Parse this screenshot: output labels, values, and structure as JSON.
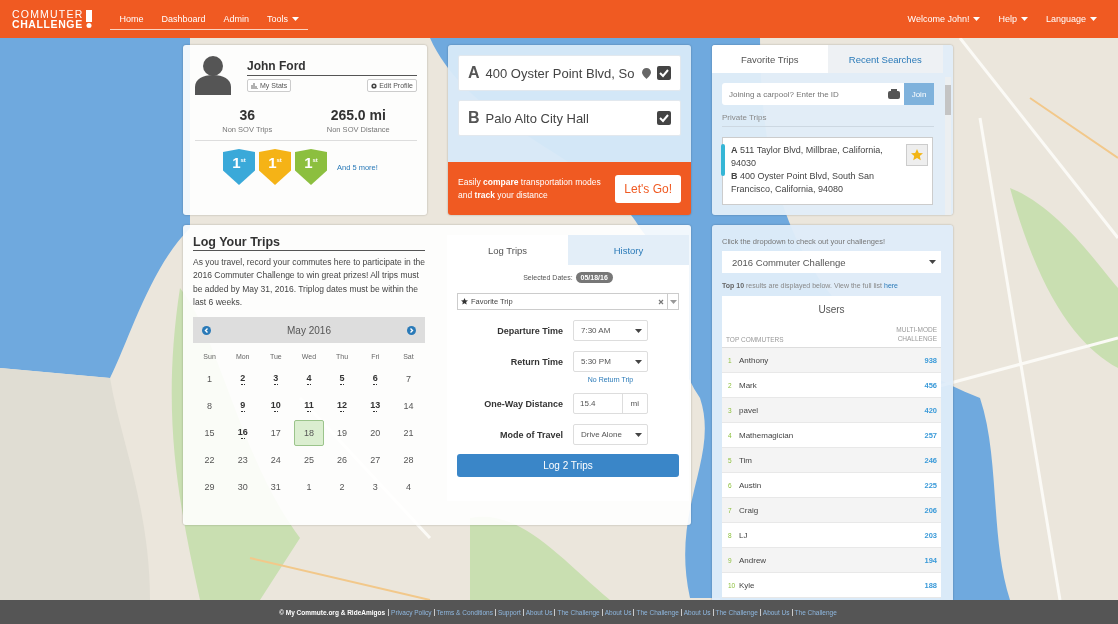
{
  "nav": {
    "logo_top": "COMMUTER",
    "logo_bottom": "CHALLENGE",
    "links": [
      {
        "label": "Home",
        "dropdown": false
      },
      {
        "label": "Dashboard",
        "dropdown": false
      },
      {
        "label": "Admin",
        "dropdown": false
      },
      {
        "label": "Tools",
        "dropdown": true
      }
    ],
    "right_links": [
      {
        "label": "Welcome John!",
        "dropdown": true
      },
      {
        "label": "Help",
        "dropdown": true
      },
      {
        "label": "Language",
        "dropdown": true
      }
    ]
  },
  "profile": {
    "name": "John Ford",
    "buttons": [
      {
        "label": "My Stats",
        "kind": "stats"
      },
      {
        "label": "Edit Profile",
        "kind": "gear"
      }
    ],
    "stats": [
      {
        "value": "36",
        "label": "Non SOV Trips"
      },
      {
        "value": "265.0 mi",
        "label": "Non SOV Distance"
      }
    ],
    "badges": [
      {
        "label": "1$^{st}$",
        "color": "#3aa9d9"
      },
      {
        "label": "1$^{st}$",
        "color": "#f5b316"
      },
      {
        "label": "1$^{st}$",
        "color": "#8cbf3f"
      }
    ],
    "more_link": "And 5 more!"
  },
  "route": {
    "stops": [
      {
        "letter": "A",
        "value": "400 Oyster Point Blvd, So",
        "checked": true
      },
      {
        "letter": "B",
        "value": "Palo Alto City Hall",
        "checked": true
      }
    ],
    "promo": "Easily **compare** transportation modes and **track** your distance",
    "button": "Let's Go!"
  },
  "favorites": {
    "tabs": [
      {
        "label": "Favorite Trips",
        "selected": true
      },
      {
        "label": "Recent Searches",
        "selected": false
      }
    ],
    "carpool": {
      "placeholder": "Joining a carpool? Enter the ID",
      "button": "Join"
    },
    "section": "Private Trips",
    "trips": [
      {
        "from_letter": "A",
        "from": "511 Taylor Blvd, Millbrae, California, 94030",
        "to_letter": "B",
        "to": "400 Oyster Point Blvd, South San Francisco, California, 94080",
        "starred": true
      }
    ]
  },
  "log": {
    "title": "Log Your Trips",
    "intro": "As you travel, record your commutes here to participate in the 2016 Commuter Challenge to win great prizes! All trips must be added by May 31, 2016. Triplog dates must be within the last 6 weeks.",
    "calendar": {
      "month": "May 2016",
      "weekdays": [
        "Sun",
        "Mon",
        "Tue",
        "Wed",
        "Thu",
        "Fri",
        "Sat"
      ],
      "weeks": [
        [
          {
            "day": "1",
            "logged": false,
            "selected": false
          },
          {
            "day": "2",
            "logged": true,
            "selected": false
          },
          {
            "day": "3",
            "logged": true,
            "selected": false
          },
          {
            "day": "4",
            "logged": true,
            "selected": false
          },
          {
            "day": "5",
            "logged": true,
            "selected": false
          },
          {
            "day": "6",
            "logged": true,
            "selected": false
          },
          {
            "day": "7",
            "logged": false,
            "selected": false
          }
        ],
        [
          {
            "day": "8",
            "logged": false,
            "selected": false
          },
          {
            "day": "9",
            "logged": true,
            "selected": false
          },
          {
            "day": "10",
            "logged": true,
            "selected": false
          },
          {
            "day": "11",
            "logged": true,
            "selected": false
          },
          {
            "day": "12",
            "logged": true,
            "selected": false
          },
          {
            "day": "13",
            "logged": true,
            "selected": false
          },
          {
            "day": "14",
            "logged": false,
            "selected": false
          }
        ],
        [
          {
            "day": "15",
            "logged": false,
            "selected": false
          },
          {
            "day": "16",
            "logged": true,
            "selected": false
          },
          {
            "day": "17",
            "logged": false,
            "selected": false
          },
          {
            "day": "18",
            "logged": false,
            "selected": true
          },
          {
            "day": "19",
            "logged": false,
            "selected": false
          },
          {
            "day": "20",
            "logged": false,
            "selected": false
          },
          {
            "day": "21",
            "logged": false,
            "selected": false
          }
        ],
        [
          {
            "day": "22",
            "logged": false,
            "selected": false
          },
          {
            "day": "23",
            "logged": false,
            "selected": false
          },
          {
            "day": "24",
            "logged": false,
            "selected": false
          },
          {
            "day": "25",
            "logged": false,
            "selected": false
          },
          {
            "day": "26",
            "logged": false,
            "selected": false
          },
          {
            "day": "27",
            "logged": false,
            "selected": false
          },
          {
            "day": "28",
            "logged": false,
            "selected": false
          }
        ],
        [
          {
            "day": "29",
            "logged": false,
            "selected": false
          },
          {
            "day": "30",
            "logged": false,
            "selected": false
          },
          {
            "day": "31",
            "logged": false,
            "selected": false
          },
          {
            "day": "1",
            "logged": false,
            "selected": false
          },
          {
            "day": "2",
            "logged": false,
            "selected": false
          },
          {
            "day": "3",
            "logged": false,
            "selected": false
          },
          {
            "day": "4",
            "logged": false,
            "selected": false
          }
        ]
      ]
    },
    "form": {
      "tabs": [
        {
          "label": "Log Trips",
          "selected": true
        },
        {
          "label": "History",
          "selected": false
        }
      ],
      "selected_dates_label": "Selected Dates:",
      "selected_dates": "05/18/16",
      "trip_select": "Favorite Trip",
      "fields": [
        {
          "label": "Departure Time",
          "kind": "select",
          "value": "7:30 AM"
        },
        {
          "label": "Return Time",
          "kind": "select",
          "value": "5:30 PM",
          "link": "No Return Trip"
        },
        {
          "label": "One-Way Distance",
          "kind": "number",
          "value": "15.4",
          "unit": "mi"
        },
        {
          "label": "Mode of Travel",
          "kind": "select",
          "value": "Drive Alone"
        }
      ],
      "submit": "Log 2 Trips"
    }
  },
  "challenge": {
    "prompt": "Click the dropdown to check out your challenges!",
    "select": "2016 Commuter Challenge",
    "note": "**Top 10** results are displayed below. View the full list ",
    "note_link": "here",
    "table": {
      "title": "Users",
      "columns": [
        "TOP COMMUTERS",
        "MULTI-MODE CHALLENGE"
      ],
      "rows": [
        {
          "rank": "1",
          "name": "Anthony",
          "score": "938"
        },
        {
          "rank": "2",
          "name": "Mark",
          "score": "456"
        },
        {
          "rank": "3",
          "name": "pavel",
          "score": "420"
        },
        {
          "rank": "4",
          "name": "Mathemagician",
          "score": "257"
        },
        {
          "rank": "5",
          "name": "Tim",
          "score": "246"
        },
        {
          "rank": "6",
          "name": "Austin",
          "score": "225"
        },
        {
          "rank": "7",
          "name": "Craig",
          "score": "206"
        },
        {
          "rank": "8",
          "name": "LJ",
          "score": "203"
        },
        {
          "rank": "9",
          "name": "Andrew",
          "score": "194"
        },
        {
          "rank": "10",
          "name": "Kyle",
          "score": "188"
        }
      ]
    }
  },
  "footer": {
    "copyright": "© My Commute.org & RideAmigos",
    "links": [
      "Privacy Policy",
      "Terms & Conditions",
      "Support",
      "About Us",
      "The Challenge",
      "About Us",
      "The Challenge",
      "About Us",
      "The Challenge",
      "About Us",
      "The Challenge"
    ]
  }
}
